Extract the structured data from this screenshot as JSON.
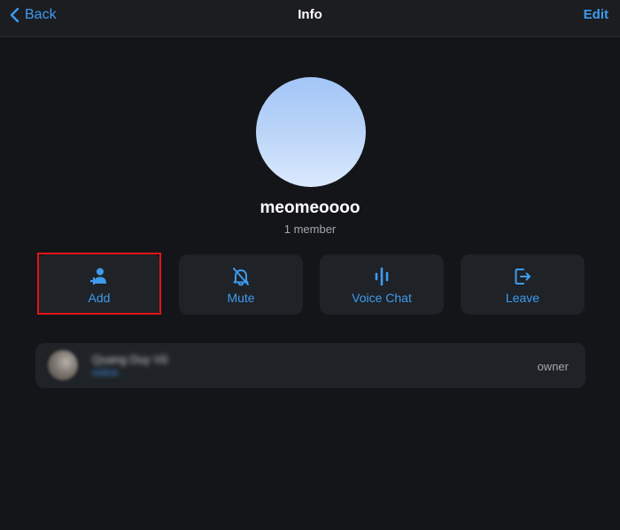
{
  "nav": {
    "back_label": "Back",
    "title": "Info",
    "edit_label": "Edit"
  },
  "group": {
    "name": "meomeoooo",
    "member_count": "1 member"
  },
  "actions": [
    {
      "label": "Add",
      "icon": "add-user-icon"
    },
    {
      "label": "Mute",
      "icon": "bell-slash-icon"
    },
    {
      "label": "Voice Chat",
      "icon": "voice-waveform-icon"
    },
    {
      "label": "Leave",
      "icon": "leave-icon"
    }
  ],
  "members": [
    {
      "name": "Quang Duy Vũ",
      "status": "online",
      "role": "owner"
    }
  ],
  "colors": {
    "accent": "#3e9bef",
    "background": "#141518",
    "card": "#1f2226",
    "highlight": "#e3151b"
  }
}
